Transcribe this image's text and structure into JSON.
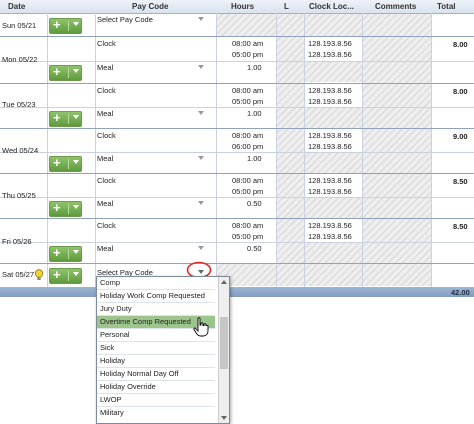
{
  "headers": {
    "date": "Date",
    "pay_code": "Pay Code",
    "hours": "Hours",
    "l": "L",
    "clock_loc": "Clock Loc...",
    "comments": "Comments",
    "total": "Total"
  },
  "rows": {
    "sun": {
      "date": "Sun 05/21",
      "pay_code": "Select Pay Code"
    },
    "mon": {
      "date": "Mon 05/22",
      "clock_label": "Clock",
      "in": "08:00 am",
      "out": "05:00 pm",
      "loc1": "128.193.8.56",
      "loc2": "128.193.8.56",
      "meal": "Meal",
      "meal_hours": "1.00",
      "total": "8.00"
    },
    "tue": {
      "date": "Tue 05/23",
      "clock_label": "Clock",
      "in": "08:00 am",
      "out": "05:00 pm",
      "loc1": "128.193.8.56",
      "loc2": "128.193.8.56",
      "meal": "Meal",
      "meal_hours": "1.00",
      "total": "8.00"
    },
    "wed": {
      "date": "Wed 05/24",
      "clock_label": "Clock",
      "in": "08:00 am",
      "out": "06:00 pm",
      "loc1": "128.193.8.56",
      "loc2": "128.193.8.56",
      "meal": "Meal",
      "meal_hours": "1.00",
      "total": "9.00"
    },
    "thu": {
      "date": "Thu 05/25",
      "clock_label": "Clock",
      "in": "08:00 am",
      "out": "05:00 pm",
      "loc1": "128.193.8.56",
      "loc2": "128.193.8.56",
      "meal": "Meal",
      "meal_hours": "0.50",
      "total": "8.50"
    },
    "fri": {
      "date": "Fri 05/26",
      "clock_label": "Clock",
      "in": "08:00 am",
      "out": "05:00 pm",
      "loc1": "128.193.8.56",
      "loc2": "128.193.8.56",
      "meal": "Meal",
      "meal_hours": "0.50",
      "total": "8.50"
    },
    "sat": {
      "date": "Sat 05/27",
      "pay_code": "Select Pay Code"
    }
  },
  "grand_total": "42.00",
  "dropdown": {
    "options": [
      "Comp",
      "Holiday Work Comp Requested",
      "Jury Duty",
      "Overtime Comp Requested",
      "Personal",
      "Sick",
      "Holiday",
      "Holiday Normal Day Off",
      "Holiday Override",
      "LWOP",
      "Military"
    ],
    "selected": "Overtime Comp Requested"
  },
  "colors": {
    "add_button": "#6aa843",
    "header_bg": "#dfe6f0",
    "total_bar": "#8ea8cb",
    "selected_option": "#9cc58b",
    "highlight_circle": "#d9302c"
  }
}
